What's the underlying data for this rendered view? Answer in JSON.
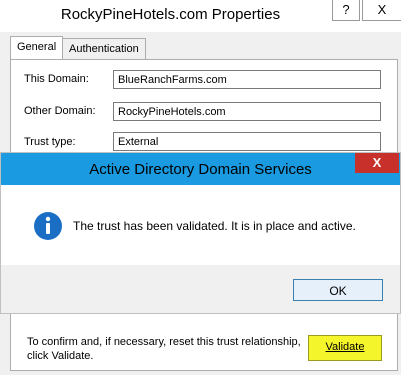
{
  "properties": {
    "title": "RockyPineHotels.com Properties",
    "help_label": "?",
    "close_label": "X",
    "tabs": [
      {
        "label": "General"
      },
      {
        "label": "Authentication"
      }
    ],
    "fields": {
      "this_domain": {
        "label": "This Domain:",
        "value": "BlueRanchFarms.com"
      },
      "other_domain": {
        "label": "Other Domain:",
        "value": "RockyPineHotels.com"
      },
      "trust_type": {
        "label": "Trust type:",
        "value": "External"
      }
    },
    "footer_text": "To confirm and, if necessary, reset this trust relationship, click Validate.",
    "validate_label": "Validate",
    "validate_highlight_color": "#f5f52c"
  },
  "dialog": {
    "title": "Active Directory Domain Services",
    "close_label": "X",
    "icon": "info-icon",
    "message": "The trust has been validated. It is in place and active.",
    "ok_label": "OK",
    "accent_color": "#1a9ae0"
  }
}
